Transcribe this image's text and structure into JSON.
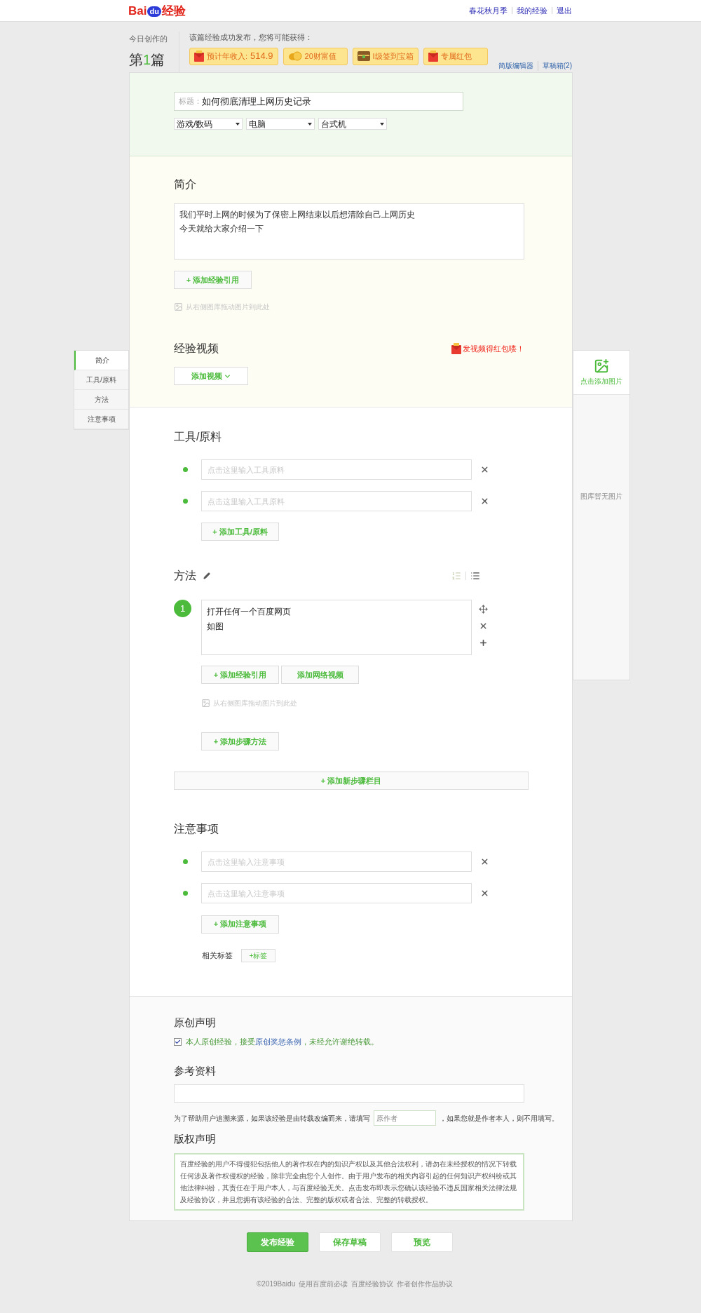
{
  "header": {
    "logo": {
      "left": "Bai",
      "paw": "du",
      "right": "经验"
    },
    "links": [
      "春花秋月季",
      "我的经验",
      "退出"
    ]
  },
  "today": {
    "label": "今日创作的",
    "prefix": "第",
    "count": "1",
    "suffix": "篇"
  },
  "rewards": {
    "intro": "该篇经验成功发布，您将可能获得：",
    "items": [
      {
        "kind": "income",
        "label": "预计年收入:",
        "value": "514.9"
      },
      {
        "kind": "coin",
        "label": "20财富值"
      },
      {
        "kind": "chest",
        "label": "I级签到宝箱"
      },
      {
        "kind": "redpacket",
        "label": "专属红包"
      }
    ]
  },
  "editor_links": [
    "简版编辑器",
    "草稿箱(2)"
  ],
  "title_field": {
    "label": "标题：",
    "value": "如何彻底清理上网历史记录"
  },
  "categories": [
    "游戏/数码",
    "电脑",
    "台式机"
  ],
  "sidebar_nav": [
    {
      "label": "简介",
      "selected": true
    },
    {
      "label": "工具/原料",
      "selected": false
    },
    {
      "label": "方法",
      "selected": false
    },
    {
      "label": "注意事项",
      "selected": false
    }
  ],
  "intro": {
    "heading": "简介",
    "lines": [
      "我们平时上网的时候为了保密上网结束以后想清除自己上网历史",
      "今天就给大家介绍一下"
    ],
    "cite_button": "+ 添加经验引用",
    "drop_hint": "从右侧图库拖动图片到此处"
  },
  "video": {
    "heading": "经验视频",
    "promo": "发视频得红包喽！",
    "button": "添加视频"
  },
  "tools": {
    "heading": "工具/原料",
    "items": [
      {
        "placeholder": "点击这里输入工具原料"
      },
      {
        "placeholder": "点击这里输入工具原料"
      }
    ],
    "add_button": "+ 添加工具/原料"
  },
  "method": {
    "heading": "方法",
    "list_modes": [
      {
        "kind": "ordered",
        "selected": false
      },
      {
        "kind": "bullet",
        "selected": true
      }
    ],
    "steps": [
      {
        "number": "1",
        "lines": [
          "打开任何一个百度网页",
          "如图"
        ]
      }
    ],
    "step_buttons": [
      "+ 添加经验引用",
      "添加网络视频"
    ],
    "drop_hint": "从右侧图库拖动图片到此处",
    "add_step": "+ 添加步骤方法",
    "add_section": "+ 添加新步骤栏目"
  },
  "notes": {
    "heading": "注意事项",
    "items": [
      {
        "placeholder": "点击这里输入注意事项"
      },
      {
        "placeholder": "点击这里输入注意事项"
      }
    ],
    "add_button": "+ 添加注意事项",
    "tags_label": "相关标签",
    "tag_button": "+标签"
  },
  "original": {
    "heading": "原创声明",
    "checked": true,
    "text_before": "本人原创经验，接受",
    "link": "原创奖惩条例",
    "text_after": "，未经允许谢绝转载。"
  },
  "references": {
    "heading": "参考资料",
    "hint_before": "为了帮助用户追溯来源，如果该经验是由转载改编而来，请填写",
    "author_placeholder": "原作者",
    "hint_after": "，如果您就是作者本人，则不用填写。"
  },
  "copyright": {
    "heading": "版权声明",
    "text": "百度经验的用户不得侵犯包括他人的著作权在内的知识产权以及其他合法权利，请勿在未经授权的情况下转载任何涉及著作权侵权的经验，除非完全由您个人创作。由于用户发布的相关内容引起的任何知识产权纠纷或其他法律纠纷，其责任在于用户本人，与百度经验无关。点击发布即表示您确认该经验不违反国家相关法律法规及经验协议，并且您拥有该经验的合法、完整的版权或者合法、完整的转载授权。"
  },
  "gallery": {
    "add_label": "点击添加图片",
    "empty": "图库暂无图片"
  },
  "actions": [
    {
      "label": "发布经验",
      "kind": "primary"
    },
    {
      "label": "保存草稿",
      "kind": "secondary"
    },
    {
      "label": "预览",
      "kind": "secondary"
    }
  ],
  "footer": [
    "©2019Baidu",
    "使用百度前必读",
    "百度经验协议",
    "作者创作作品协议"
  ]
}
